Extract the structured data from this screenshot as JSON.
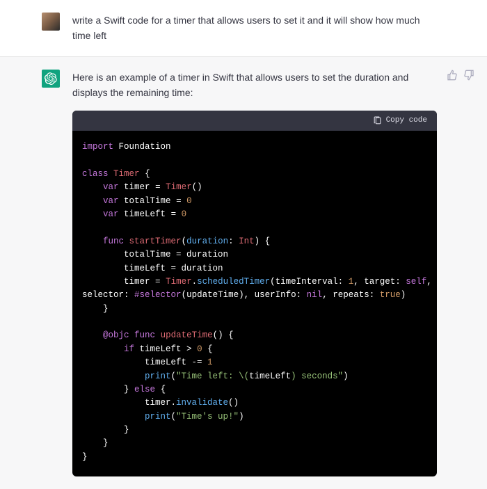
{
  "user_message": "write a Swift code for a timer that allows users to set it and it will show how much time left",
  "assistant_intro": "Here is an example of a timer in Swift that allows users to set the duration and displays the remaining time:",
  "copy_label": "Copy code",
  "code": {
    "t_import": "import",
    "t_foundation": "Foundation",
    "t_class": "class",
    "t_Timer": "Timer",
    "brace_open": "{",
    "brace_close": "}",
    "t_var": "var",
    "v_timer": "timer",
    "eq": "=",
    "call_Timer": "Timer",
    "paren_pair": "()",
    "v_totalTime": "totalTime",
    "zero": "0",
    "v_timeLeft": "timeLeft",
    "t_func": "func",
    "fn_startTimer": "startTimer",
    "p_open": "(",
    "p_close": ")",
    "lbl_duration": "duration",
    "colon": ":",
    "t_Int": "Int",
    "assign_total": "totalTime = duration",
    "assign_left": "timeLeft = duration",
    "dot": ".",
    "fn_scheduledTimer": "scheduledTimer",
    "arg_timeInterval": "timeInterval",
    "num_one": "1",
    "arg_target": "target",
    "t_self": "self",
    "arg_selector": "selector",
    "hash_selector": "#selector",
    "sel_updateTime": "updateTime",
    "arg_userInfo": "userInfo",
    "t_nil": "nil",
    "arg_repeats": "repeats",
    "t_true": "true",
    "t_objc": "@objc",
    "fn_updateTime": "updateTime",
    "t_if": "if",
    "cond": "timeLeft > ",
    "t_else": "else",
    "stmt_dec_a": "timeLeft -= ",
    "fn_print": "print",
    "str_left_a": "\"Time left: ",
    "interp_open": "\\(",
    "interp_var": "timeLeft",
    "interp_close": ")",
    "str_left_b": " seconds\"",
    "stmt_invalidate_a": "timer.",
    "fn_invalidate": "invalidate",
    "str_up": "\"Time's up!\"",
    "comma_sp": ", "
  }
}
